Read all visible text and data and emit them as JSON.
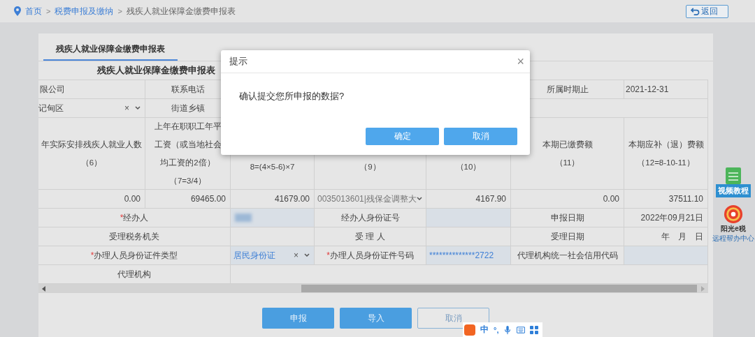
{
  "breadcrumb": [
    {
      "label": "首页",
      "kind": "home"
    },
    {
      "label": "税费申报及缴纳",
      "kind": "link"
    },
    {
      "label": "残疾人就业保障金缴费申报表",
      "kind": "current"
    }
  ],
  "separator": ">",
  "back_button": "返回",
  "tabs": [
    {
      "label": "残疾人就业保障金缴费申报表",
      "selected": true
    }
  ],
  "form_title": "残疾人就业保障金缴费申报表",
  "required_mark": "*",
  "rows": [
    {
      "kind": "plain",
      "cells": [
        {
          "kind": "value",
          "text": "限公司"
        },
        {
          "kind": "label",
          "text": "联系电话"
        },
        {
          "kind": "covered"
        },
        {
          "kind": "covered"
        },
        {
          "kind": "covered"
        },
        {
          "kind": "label",
          "text": "所属时期止"
        },
        {
          "kind": "value",
          "text": "2021-12-31"
        }
      ]
    },
    {
      "kind": "plain",
      "cells": [
        {
          "kind": "select",
          "text": "记甸区",
          "clear": "×"
        },
        {
          "kind": "label",
          "text": "街道乡镇"
        },
        {
          "kind": "blank"
        }
      ]
    },
    {
      "kind": "plain",
      "cells": [
        {
          "kind": "header",
          "lines": [
            "年实际安排残疾人就业人数",
            "（6）"
          ]
        },
        {
          "kind": "header",
          "lines": [
            "上年在职职工年平",
            "工资（或当地社会",
            "均工资的2倍）",
            "（7=3/4）"
          ]
        },
        {
          "kind": "header-low",
          "lines": [
            "8=(4×5-6)×7"
          ]
        },
        {
          "kind": "header-low",
          "lines": [
            "（9）"
          ]
        },
        {
          "kind": "header-low",
          "lines": [
            "（10）"
          ]
        },
        {
          "kind": "header",
          "lines": [
            "本期已缴费额",
            "（11）"
          ]
        },
        {
          "kind": "header",
          "lines": [
            "本期应补（退）费额",
            "（12=8-10-11）"
          ]
        }
      ]
    },
    {
      "kind": "plain",
      "cells": [
        {
          "kind": "number",
          "text": "0.00"
        },
        {
          "kind": "number",
          "text": "69465.00"
        },
        {
          "kind": "number",
          "text": "41679.00"
        },
        {
          "kind": "select",
          "text": "0035013601|残保金调整大",
          "muted": true
        },
        {
          "kind": "number",
          "text": "4167.90"
        },
        {
          "kind": "number",
          "text": "0.00"
        },
        {
          "kind": "number",
          "text": "37511.10"
        }
      ]
    },
    {
      "kind": "wide-label",
      "cells": [
        {
          "kind": "required",
          "text": "经办人"
        },
        {
          "kind": "blurred"
        },
        {
          "kind": "label",
          "text": "经办人身份证号"
        },
        {
          "kind": "field"
        },
        {
          "kind": "label",
          "text": "申报日期"
        },
        {
          "kind": "date",
          "text": "2022年09月21日"
        }
      ]
    },
    {
      "kind": "wide-label",
      "cells": [
        {
          "kind": "label",
          "text": "受理税务机关"
        },
        {
          "kind": "blank"
        },
        {
          "kind": "label",
          "text": "受 理 人"
        },
        {
          "kind": "blank"
        },
        {
          "kind": "label",
          "text": "受理日期"
        },
        {
          "kind": "date",
          "text": "年　月　日"
        }
      ]
    },
    {
      "kind": "wide-label",
      "cells": [
        {
          "kind": "required",
          "text": "办理人员身份证件类型"
        },
        {
          "kind": "select",
          "text": "居民身份证",
          "clear": "×"
        },
        {
          "kind": "required",
          "text": "办理人员身份证件号码"
        },
        {
          "kind": "field",
          "text": "**************2722"
        },
        {
          "kind": "label",
          "text": "代理机构统一社会信用代码"
        },
        {
          "kind": "field"
        }
      ]
    },
    {
      "kind": "wide-label",
      "cells": [
        {
          "kind": "label",
          "text": "代理机构"
        },
        {
          "kind": "blank"
        }
      ]
    }
  ],
  "actions": [
    {
      "label": "申报",
      "kind": "primary"
    },
    {
      "label": "导入",
      "kind": "primary"
    },
    {
      "label": "取消",
      "kind": "outline"
    }
  ],
  "side_widgets": [
    {
      "label": "视频教程",
      "kind": "video"
    },
    {
      "label": "远程帮办中心",
      "brand": "阳光e税",
      "kind": "logo"
    }
  ],
  "dialog": {
    "title": "提示",
    "close": "×",
    "message": "确认提交您所申报的数据?",
    "buttons": [
      "确定",
      "取消"
    ]
  },
  "ime_bar": {
    "mode": "中",
    "punct": "°,"
  }
}
